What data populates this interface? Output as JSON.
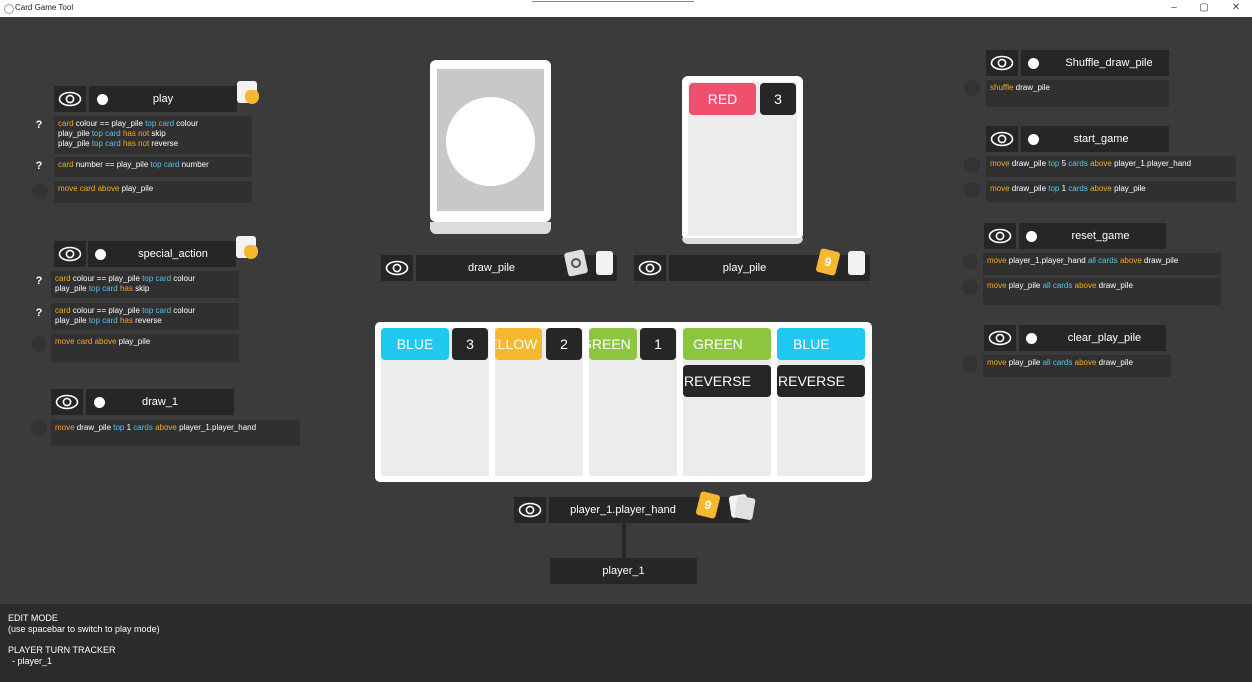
{
  "window": {
    "title": "Card Game Tool",
    "minimize": "–",
    "maximize": "▢",
    "close": "✕"
  },
  "colors": {
    "red": "#f0506e",
    "blue": "#1ec8f0",
    "yellow": "#f5b82e",
    "green": "#8cc63f",
    "dark": "#262626"
  },
  "rules_left": {
    "play": {
      "title": "play",
      "conditions": [
        {
          "marker": "?",
          "lines": [
            [
              {
                "t": "card",
                "c": "kw"
              },
              {
                "t": " colour == play_pile "
              },
              {
                "t": "top card",
                "c": "bl"
              },
              {
                "t": " colour"
              }
            ],
            [
              {
                "t": "play_pile "
              },
              {
                "t": "top card",
                "c": "bl"
              },
              {
                "t": " "
              },
              {
                "t": "has not",
                "c": "kw"
              },
              {
                "t": " skip"
              }
            ],
            [
              {
                "t": "play_pile "
              },
              {
                "t": "top card",
                "c": "bl"
              },
              {
                "t": " "
              },
              {
                "t": "has not",
                "c": "kw"
              },
              {
                "t": " reverse"
              }
            ]
          ]
        },
        {
          "marker": "?",
          "lines": [
            [
              {
                "t": "card",
                "c": "kw"
              },
              {
                "t": " number == play_pile "
              },
              {
                "t": "top card",
                "c": "bl"
              },
              {
                "t": " number"
              }
            ]
          ]
        },
        {
          "marker": "",
          "lines": [
            [
              {
                "t": "move",
                "c": "kw"
              },
              {
                "t": " "
              },
              {
                "t": "card",
                "c": "kw"
              },
              {
                "t": " "
              },
              {
                "t": "above",
                "c": "kw"
              },
              {
                "t": " play_pile"
              }
            ]
          ]
        }
      ]
    },
    "special_action": {
      "title": "special_action",
      "conditions": [
        {
          "marker": "?",
          "lines": [
            [
              {
                "t": "card",
                "c": "kw"
              },
              {
                "t": " colour == play_pile "
              },
              {
                "t": "top card",
                "c": "bl"
              },
              {
                "t": " colour"
              }
            ],
            [
              {
                "t": "play_pile "
              },
              {
                "t": "top card",
                "c": "bl"
              },
              {
                "t": " "
              },
              {
                "t": "has",
                "c": "kw"
              },
              {
                "t": " skip"
              }
            ]
          ]
        },
        {
          "marker": "?",
          "lines": [
            [
              {
                "t": "card",
                "c": "kw"
              },
              {
                "t": " colour == play_pile "
              },
              {
                "t": "top card",
                "c": "bl"
              },
              {
                "t": " colour"
              }
            ],
            [
              {
                "t": "play_pile "
              },
              {
                "t": "top card",
                "c": "bl"
              },
              {
                "t": " "
              },
              {
                "t": "has",
                "c": "kw"
              },
              {
                "t": " reverse"
              }
            ]
          ]
        },
        {
          "marker": "",
          "lines": [
            [
              {
                "t": "move",
                "c": "kw"
              },
              {
                "t": " "
              },
              {
                "t": "card",
                "c": "kw"
              },
              {
                "t": " "
              },
              {
                "t": "above",
                "c": "kw"
              },
              {
                "t": " play_pile"
              }
            ]
          ]
        }
      ]
    },
    "draw_1": {
      "title": "draw_1",
      "conditions": [
        {
          "marker": "",
          "lines": [
            [
              {
                "t": "move",
                "c": "kw"
              },
              {
                "t": " draw_pile "
              },
              {
                "t": "top",
                "c": "bl"
              },
              {
                "t": " 1 "
              },
              {
                "t": "cards",
                "c": "bl"
              },
              {
                "t": " "
              },
              {
                "t": "above",
                "c": "kw"
              },
              {
                "t": " player_1.player_hand"
              }
            ]
          ]
        }
      ]
    }
  },
  "rules_right": {
    "shuffle": {
      "title": "Shuffle_draw_pile",
      "line": [
        {
          "t": "shuffle",
          "c": "kw"
        },
        {
          "t": " draw_pile"
        }
      ]
    },
    "start_game": {
      "title": "start_game",
      "lines": [
        [
          {
            "t": "move",
            "c": "kw"
          },
          {
            "t": " draw_pile "
          },
          {
            "t": "top",
            "c": "bl"
          },
          {
            "t": " 5 "
          },
          {
            "t": "cards",
            "c": "bl"
          },
          {
            "t": " "
          },
          {
            "t": "above",
            "c": "kw"
          },
          {
            "t": " player_1.player_hand"
          }
        ],
        [
          {
            "t": "move",
            "c": "kw"
          },
          {
            "t": " draw_pile "
          },
          {
            "t": "top",
            "c": "bl"
          },
          {
            "t": " 1 "
          },
          {
            "t": "cards",
            "c": "bl"
          },
          {
            "t": " "
          },
          {
            "t": "above",
            "c": "kw"
          },
          {
            "t": " play_pile"
          }
        ]
      ]
    },
    "reset_game": {
      "title": "reset_game",
      "lines": [
        [
          {
            "t": "move",
            "c": "kw"
          },
          {
            "t": " player_1.player_hand "
          },
          {
            "t": "all cards",
            "c": "bl"
          },
          {
            "t": " "
          },
          {
            "t": "above",
            "c": "kw"
          },
          {
            "t": " draw_pile"
          }
        ],
        [
          {
            "t": "move",
            "c": "kw"
          },
          {
            "t": " play_pile "
          },
          {
            "t": "all cards",
            "c": "bl"
          },
          {
            "t": " "
          },
          {
            "t": "above",
            "c": "kw"
          },
          {
            "t": " draw_pile"
          }
        ]
      ]
    },
    "clear_play_pile": {
      "title": "clear_play_pile",
      "lines": [
        [
          {
            "t": "move",
            "c": "kw"
          },
          {
            "t": " play_pile "
          },
          {
            "t": "all cards",
            "c": "bl"
          },
          {
            "t": " "
          },
          {
            "t": "above",
            "c": "kw"
          },
          {
            "t": " draw_pile"
          }
        ]
      ]
    }
  },
  "piles": {
    "draw_pile": {
      "label": "draw_pile"
    },
    "play_pile": {
      "label": "play_pile",
      "top_card": {
        "colour": "RED",
        "number": "3"
      }
    },
    "player_hand": {
      "label": "player_1.player_hand",
      "player": "player_1",
      "cards": [
        {
          "colour": "BLUE",
          "number": "3",
          "action": ""
        },
        {
          "colour": "YELLOW",
          "number": "2",
          "action": ""
        },
        {
          "colour": "GREEN",
          "number": "1",
          "action": ""
        },
        {
          "colour": "GREEN",
          "number": "",
          "action": "REVERSE"
        },
        {
          "colour": "BLUE",
          "number": "",
          "action": "REVERSE"
        }
      ]
    }
  },
  "icons": {
    "eye": "eye-icon",
    "hand": "hand-icon",
    "shuffle": "shuffle-icon",
    "card_stack": "card-stack-icon",
    "radio": "radio-dot-icon"
  },
  "footer": {
    "mode": "EDIT MODE",
    "hint": "(use spacebar to switch to play mode)",
    "tracker_title": "PLAYER TURN TRACKER",
    "tracker_value": "- player_1"
  }
}
